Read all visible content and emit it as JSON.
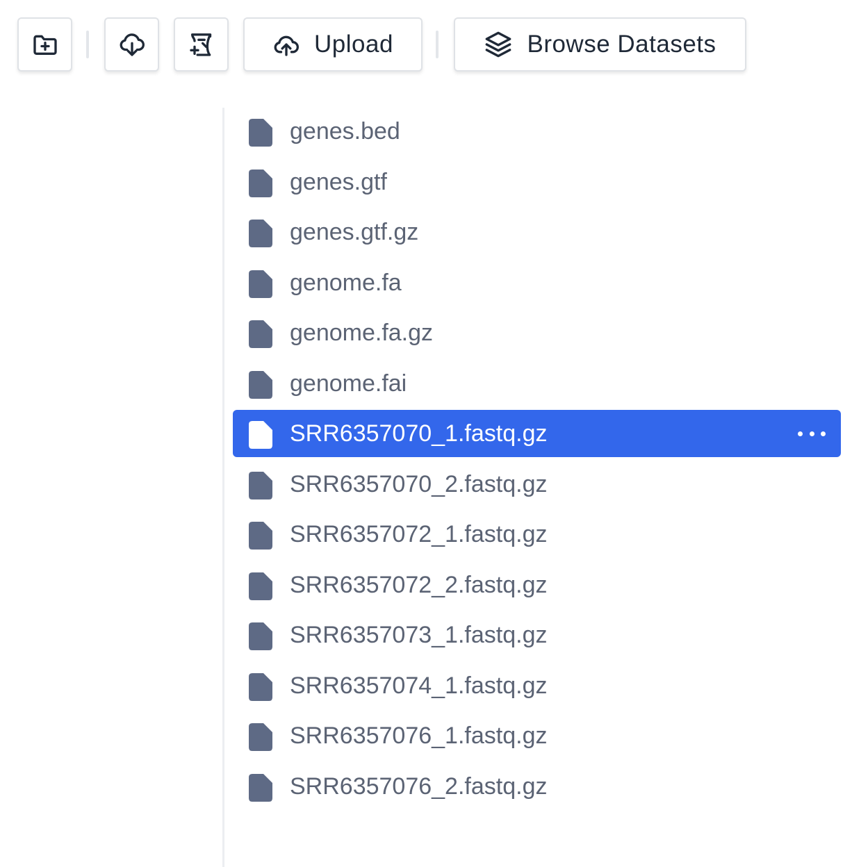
{
  "toolbar": {
    "new_folder_icon": "folder-plus-icon",
    "download_icon": "cloud-download-icon",
    "new_file_icon": "file-plus-icon",
    "upload_icon": "cloud-upload-icon",
    "upload_label": "Upload",
    "browse_icon": "layers-icon",
    "browse_label": "Browse Datasets"
  },
  "files": [
    {
      "name": "genes.bed",
      "selected": false
    },
    {
      "name": "genes.gtf",
      "selected": false
    },
    {
      "name": "genes.gtf.gz",
      "selected": false
    },
    {
      "name": "genome.fa",
      "selected": false
    },
    {
      "name": "genome.fa.gz",
      "selected": false
    },
    {
      "name": "genome.fai",
      "selected": false
    },
    {
      "name": "SRR6357070_1.fastq.gz",
      "selected": true
    },
    {
      "name": "SRR6357070_2.fastq.gz",
      "selected": false
    },
    {
      "name": "SRR6357072_1.fastq.gz",
      "selected": false
    },
    {
      "name": "SRR6357072_2.fastq.gz",
      "selected": false
    },
    {
      "name": "SRR6357073_1.fastq.gz",
      "selected": false
    },
    {
      "name": "SRR6357074_1.fastq.gz",
      "selected": false
    },
    {
      "name": "SRR6357076_1.fastq.gz",
      "selected": false
    },
    {
      "name": "SRR6357076_2.fastq.gz",
      "selected": false
    }
  ],
  "colors": {
    "selected_bg": "#3367eb",
    "file_icon": "#5e6a85",
    "file_icon_selected": "#ffffff",
    "file_text": "#5b6374"
  }
}
